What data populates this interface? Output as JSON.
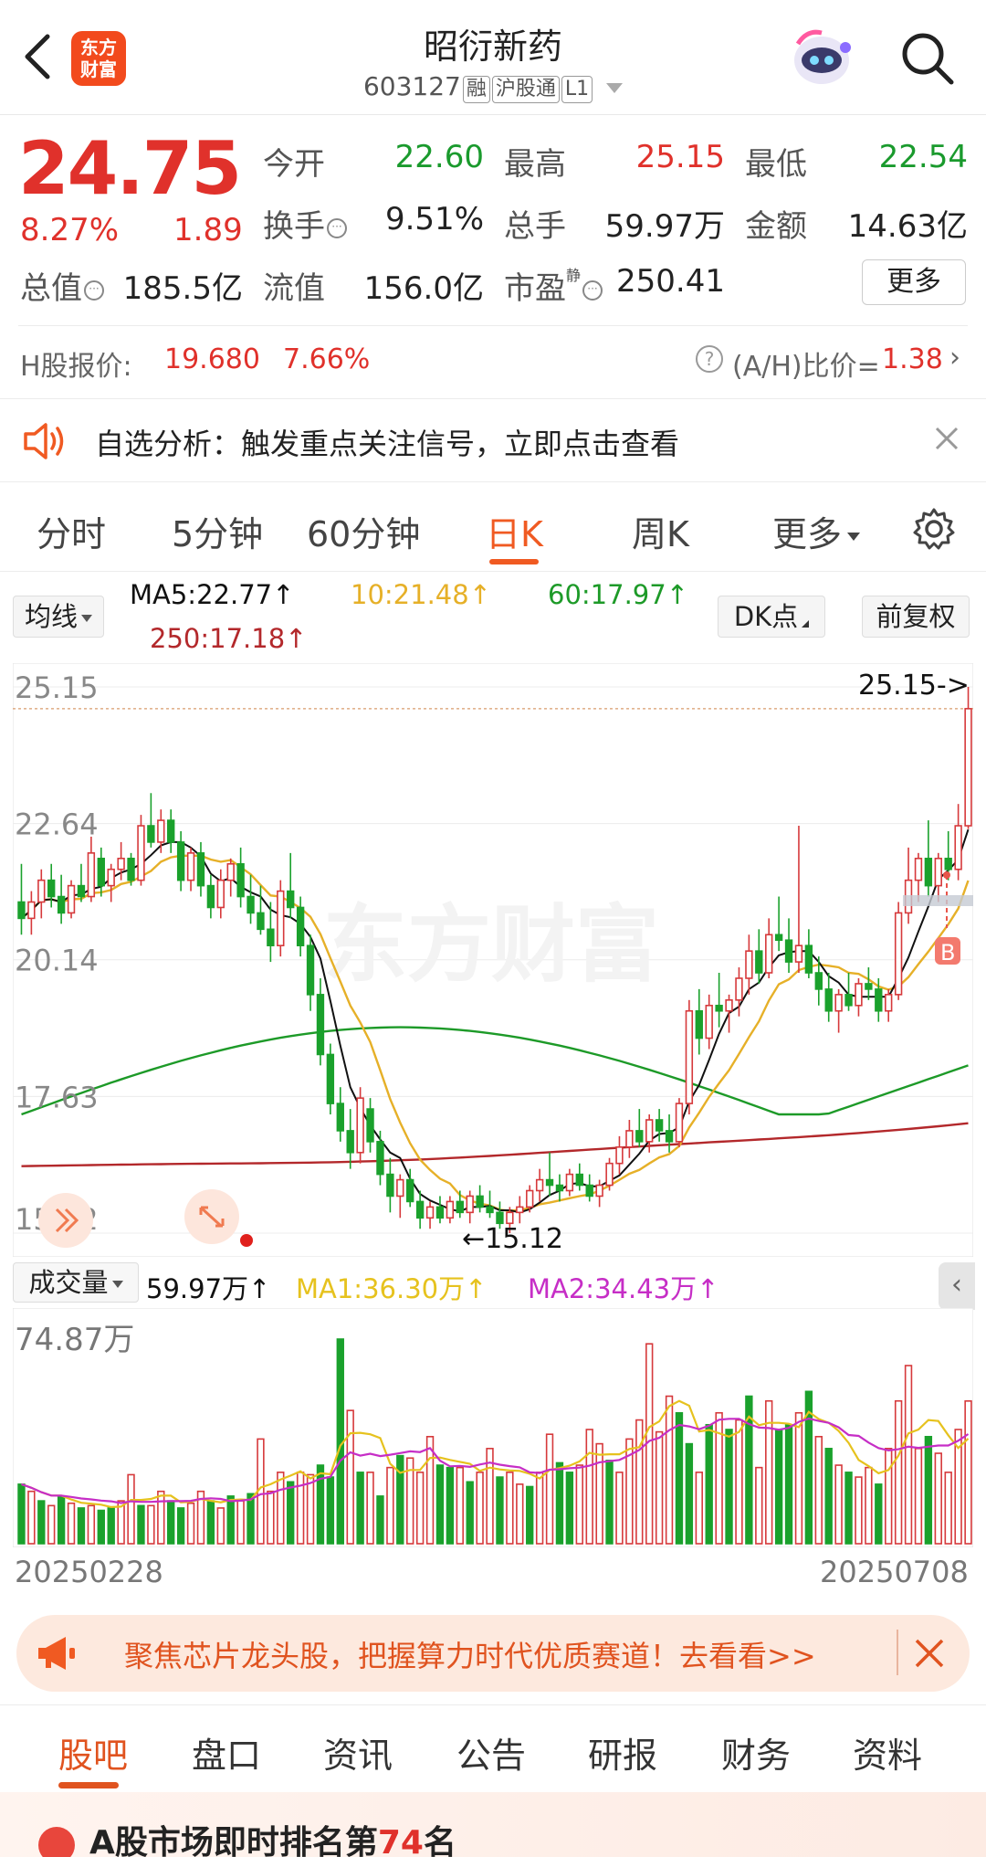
{
  "header": {
    "stock_name": "昭衍新药",
    "code": "603127",
    "tags": [
      "融",
      "沪股通",
      "L1"
    ],
    "logo_text": "东方财富"
  },
  "quote": {
    "price": "24.75",
    "change_pct": "8.27%",
    "change_amt": "1.89",
    "open_label": "今开",
    "open": "22.60",
    "high_label": "最高",
    "high": "25.15",
    "low_label": "最低",
    "low": "22.54",
    "turnover_label": "换手",
    "turnover": "9.51%",
    "volume_label": "总手",
    "volume": "59.97万",
    "amount_label": "金额",
    "amount": "14.63亿",
    "mcap_label": "总值",
    "mcap": "185.5亿",
    "float_label": "流值",
    "float": "156.0亿",
    "pe_label": "市盈",
    "pe_sup": "静",
    "pe": "250.41",
    "more_label": "更多"
  },
  "hshare": {
    "label": "H股报价:",
    "price": "19.680",
    "pct": "7.66%",
    "ratio_label": "(A/H)比价=",
    "ratio": "1.38"
  },
  "signal": {
    "text": "自选分析：触发重点关注信号，立即点击查看"
  },
  "tabs": [
    "分时",
    "5分钟",
    "60分钟",
    "日K",
    "周K",
    "更多"
  ],
  "ma_bar": {
    "selector": "均线",
    "ma5": "MA5:22.77↑",
    "ma10": "10:21.48↑",
    "ma60": "60:17.97↑",
    "ma250": "250:17.18↑",
    "dk": "DK点",
    "adjust": "前复权"
  },
  "chart_data": {
    "type": "candlestick",
    "yticks": [
      "25.15",
      "22.64",
      "20.14",
      "17.63",
      "15.12"
    ],
    "ylim": [
      15.12,
      25.15
    ],
    "high_marker": "25.15->",
    "low_marker": "←15.12",
    "buy_marker": "B",
    "volume_label": "成交量",
    "volume": "59.97万↑",
    "vol_ma1": "MA1:36.30万↑",
    "vol_ma2": "MA2:34.43万↑",
    "vol_max": "74.87万",
    "date_start": "20250228",
    "date_end": "20250708",
    "colors": {
      "up": "#d6393b",
      "down": "#1aa12c",
      "ma5": "#111111",
      "ma10": "#e6b028",
      "ma60": "#1d9a28",
      "ma250": "#b3282b",
      "vma1": "#e6c21e",
      "vma2": "#c62ec6"
    },
    "candles": [
      [
        21.2,
        21.9,
        20.6,
        20.9
      ],
      [
        20.9,
        21.4,
        20.6,
        21.2
      ],
      [
        21.2,
        21.8,
        20.9,
        21.6
      ],
      [
        21.6,
        21.9,
        21.1,
        21.3
      ],
      [
        21.3,
        21.7,
        20.8,
        21.0
      ],
      [
        21.0,
        21.6,
        20.9,
        21.5
      ],
      [
        21.5,
        21.9,
        21.2,
        21.3
      ],
      [
        21.3,
        22.4,
        21.2,
        22.1
      ],
      [
        22.0,
        22.2,
        21.3,
        21.5
      ],
      [
        21.5,
        21.9,
        21.2,
        21.8
      ],
      [
        21.8,
        22.3,
        21.6,
        22.0
      ],
      [
        22.0,
        22.1,
        21.5,
        21.6
      ],
      [
        21.6,
        22.8,
        21.5,
        22.6
      ],
      [
        22.6,
        23.2,
        22.2,
        22.3
      ],
      [
        22.3,
        22.9,
        22.1,
        22.7
      ],
      [
        22.7,
        22.9,
        22.1,
        22.3
      ],
      [
        22.3,
        22.5,
        21.4,
        21.6
      ],
      [
        21.6,
        22.2,
        21.4,
        22.1
      ],
      [
        22.1,
        22.3,
        21.3,
        21.5
      ],
      [
        21.5,
        21.7,
        20.9,
        21.1
      ],
      [
        21.1,
        21.8,
        20.9,
        21.6
      ],
      [
        21.6,
        22.0,
        21.3,
        21.9
      ],
      [
        21.9,
        22.2,
        21.1,
        21.3
      ],
      [
        21.3,
        21.7,
        20.8,
        21.0
      ],
      [
        21.0,
        21.5,
        20.6,
        20.7
      ],
      [
        20.7,
        21.2,
        20.1,
        20.4
      ],
      [
        20.4,
        21.6,
        20.2,
        21.4
      ],
      [
        21.4,
        22.1,
        20.9,
        21.1
      ],
      [
        21.1,
        21.3,
        20.2,
        20.4
      ],
      [
        20.4,
        20.6,
        19.2,
        19.5
      ],
      [
        19.5,
        19.8,
        18.2,
        18.4
      ],
      [
        18.4,
        18.6,
        17.3,
        17.5
      ],
      [
        17.5,
        17.8,
        16.8,
        17.0
      ],
      [
        17.0,
        17.4,
        16.3,
        16.6
      ],
      [
        16.6,
        17.8,
        16.4,
        17.6
      ],
      [
        17.4,
        17.6,
        16.6,
        16.8
      ],
      [
        16.8,
        17.0,
        16.0,
        16.2
      ],
      [
        16.2,
        16.5,
        15.5,
        15.8
      ],
      [
        15.8,
        16.2,
        15.4,
        16.1
      ],
      [
        16.1,
        16.3,
        15.6,
        15.7
      ],
      [
        15.7,
        15.9,
        15.2,
        15.4
      ],
      [
        15.4,
        15.7,
        15.2,
        15.6
      ],
      [
        15.6,
        15.8,
        15.3,
        15.4
      ],
      [
        15.4,
        15.8,
        15.3,
        15.7
      ],
      [
        15.7,
        15.9,
        15.4,
        15.5
      ],
      [
        15.5,
        15.9,
        15.3,
        15.8
      ],
      [
        15.8,
        16.0,
        15.5,
        15.6
      ],
      [
        15.6,
        15.9,
        15.4,
        15.5
      ],
      [
        15.5,
        15.7,
        15.2,
        15.3
      ],
      [
        15.3,
        15.6,
        15.12,
        15.5
      ],
      [
        15.5,
        15.8,
        15.3,
        15.6
      ],
      [
        15.6,
        16.0,
        15.5,
        15.9
      ],
      [
        15.9,
        16.3,
        15.7,
        16.1
      ],
      [
        16.1,
        16.6,
        15.8,
        16.0
      ],
      [
        16.0,
        16.2,
        15.7,
        15.9
      ],
      [
        15.9,
        16.3,
        15.8,
        16.2
      ],
      [
        16.2,
        16.4,
        15.9,
        16.0
      ],
      [
        16.0,
        16.2,
        15.7,
        15.8
      ],
      [
        15.8,
        16.1,
        15.6,
        16.0
      ],
      [
        16.0,
        16.5,
        15.9,
        16.4
      ],
      [
        16.4,
        16.9,
        16.2,
        16.7
      ],
      [
        16.7,
        17.2,
        16.5,
        17.0
      ],
      [
        17.0,
        17.4,
        16.7,
        16.8
      ],
      [
        16.8,
        17.3,
        16.6,
        17.2
      ],
      [
        17.2,
        17.4,
        16.8,
        17.0
      ],
      [
        17.0,
        17.3,
        16.6,
        16.8
      ],
      [
        16.8,
        17.6,
        16.7,
        17.5
      ],
      [
        17.5,
        19.4,
        17.3,
        19.2
      ],
      [
        19.2,
        19.6,
        18.4,
        18.7
      ],
      [
        18.7,
        19.5,
        18.5,
        19.3
      ],
      [
        19.3,
        19.9,
        18.9,
        19.2
      ],
      [
        19.2,
        19.5,
        18.8,
        19.4
      ],
      [
        19.4,
        20.0,
        19.1,
        19.8
      ],
      [
        19.8,
        20.6,
        19.5,
        20.3
      ],
      [
        20.3,
        20.7,
        19.7,
        19.9
      ],
      [
        19.9,
        20.9,
        19.8,
        20.6
      ],
      [
        20.6,
        21.3,
        20.3,
        20.5
      ],
      [
        20.5,
        20.9,
        19.9,
        20.1
      ],
      [
        20.1,
        22.6,
        19.9,
        20.4
      ],
      [
        20.4,
        20.7,
        19.8,
        19.9
      ],
      [
        19.9,
        20.2,
        19.3,
        19.6
      ],
      [
        19.6,
        19.9,
        19.0,
        19.2
      ],
      [
        19.2,
        19.6,
        18.8,
        19.5
      ],
      [
        19.5,
        19.9,
        19.2,
        19.3
      ],
      [
        19.3,
        19.8,
        19.1,
        19.7
      ],
      [
        19.7,
        20.0,
        19.4,
        19.6
      ],
      [
        19.6,
        19.8,
        19.0,
        19.2
      ],
      [
        19.2,
        19.6,
        19.0,
        19.5
      ],
      [
        19.5,
        21.2,
        19.4,
        21.0
      ],
      [
        21.0,
        22.2,
        20.8,
        21.6
      ],
      [
        21.6,
        22.1,
        21.2,
        22.0
      ],
      [
        22.0,
        22.7,
        21.3,
        21.5
      ],
      [
        21.5,
        22.1,
        21.2,
        22.0
      ],
      [
        22.0,
        22.5,
        21.6,
        21.8
      ],
      [
        21.8,
        23.0,
        21.6,
        22.6
      ],
      [
        22.6,
        25.15,
        22.54,
        24.75
      ]
    ],
    "volumes": [
      [
        25,
        0
      ],
      [
        22,
        1
      ],
      [
        18,
        0
      ],
      [
        16,
        1
      ],
      [
        20,
        0
      ],
      [
        17,
        1
      ],
      [
        15,
        0
      ],
      [
        16,
        1
      ],
      [
        14,
        0
      ],
      [
        15,
        0
      ],
      [
        18,
        1
      ],
      [
        29,
        1
      ],
      [
        16,
        0
      ],
      [
        16,
        1
      ],
      [
        22,
        1
      ],
      [
        18,
        0
      ],
      [
        15,
        0
      ],
      [
        17,
        1
      ],
      [
        22,
        1
      ],
      [
        18,
        0
      ],
      [
        15,
        1
      ],
      [
        20,
        0
      ],
      [
        18,
        1
      ],
      [
        21,
        0
      ],
      [
        44,
        1
      ],
      [
        22,
        1
      ],
      [
        30,
        1
      ],
      [
        26,
        0
      ],
      [
        30,
        1
      ],
      [
        29,
        1
      ],
      [
        33,
        0
      ],
      [
        28,
        0
      ],
      [
        86,
        0
      ],
      [
        56,
        1
      ],
      [
        30,
        0
      ],
      [
        30,
        1
      ],
      [
        20,
        0
      ],
      [
        32,
        1
      ],
      [
        37,
        0
      ],
      [
        36,
        1
      ],
      [
        30,
        1
      ],
      [
        45,
        1
      ],
      [
        33,
        0
      ],
      [
        32,
        0
      ],
      [
        32,
        1
      ],
      [
        26,
        0
      ],
      [
        30,
        1
      ],
      [
        40,
        1
      ],
      [
        28,
        0
      ],
      [
        30,
        1
      ],
      [
        25,
        1
      ],
      [
        24,
        0
      ],
      [
        30,
        1
      ],
      [
        46,
        1
      ],
      [
        34,
        0
      ],
      [
        30,
        0
      ],
      [
        33,
        1
      ],
      [
        48,
        1
      ],
      [
        42,
        1
      ],
      [
        35,
        0
      ],
      [
        30,
        1
      ],
      [
        44,
        1
      ],
      [
        52,
        1
      ],
      [
        84,
        1
      ],
      [
        47,
        1
      ],
      [
        62,
        1
      ],
      [
        55,
        0
      ],
      [
        42,
        0
      ],
      [
        30,
        1
      ],
      [
        50,
        0
      ],
      [
        55,
        1
      ],
      [
        48,
        0
      ],
      [
        52,
        1
      ],
      [
        62,
        0
      ],
      [
        32,
        1
      ],
      [
        60,
        1
      ],
      [
        48,
        0
      ],
      [
        50,
        0
      ],
      [
        55,
        1
      ],
      [
        64,
        0
      ],
      [
        45,
        1
      ],
      [
        40,
        0
      ],
      [
        33,
        1
      ],
      [
        30,
        0
      ],
      [
        28,
        1
      ],
      [
        32,
        1
      ],
      [
        25,
        0
      ],
      [
        40,
        1
      ],
      [
        60,
        1
      ],
      [
        74.87,
        1
      ],
      [
        40,
        1
      ],
      [
        45,
        0
      ],
      [
        38,
        1
      ],
      [
        30,
        1
      ],
      [
        48,
        1
      ],
      [
        59.97,
        1
      ]
    ]
  },
  "promo": {
    "text": "聚焦芯片龙头股，把握算力时代优质赛道！去看看>>"
  },
  "bottom_tabs": [
    "股吧",
    "盘口",
    "资讯",
    "公告",
    "研报",
    "财务",
    "资料"
  ],
  "rank": {
    "prefix": "A股市场即时排名第",
    "num": "74",
    "suffix": "名"
  }
}
